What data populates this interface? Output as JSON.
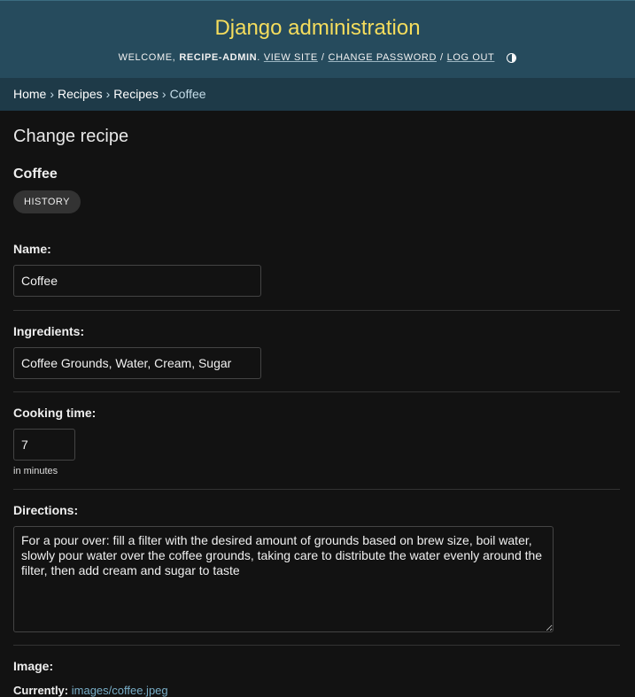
{
  "header": {
    "site_title": "Django administration",
    "welcome": "WELCOME,",
    "username": "RECIPE-ADMIN",
    "period": ".",
    "view_site": "VIEW SITE",
    "change_password": "CHANGE PASSWORD",
    "log_out": "LOG OUT",
    "sep": "/"
  },
  "breadcrumbs": [
    "Home",
    "Recipes",
    "Recipes",
    "Coffee"
  ],
  "page": {
    "title": "Change recipe",
    "object_name": "Coffee",
    "history_label": "HISTORY"
  },
  "form": {
    "name_label": "Name:",
    "name_value": "Coffee",
    "ingredients_label": "Ingredients:",
    "ingredients_value": "Coffee Grounds, Water, Cream, Sugar",
    "cooking_time_label": "Cooking time:",
    "cooking_time_value": "7",
    "cooking_time_help": "in minutes",
    "directions_label": "Directions:",
    "directions_value": "For a pour over: fill a filter with the desired amount of grounds based on brew size, boil water, slowly pour water over the coffee grounds, taking care to distribute the water evenly around the filter, then add cream and sugar to taste",
    "image_label": "Image:",
    "currently_label": "Currently:",
    "currently_value": "images/coffee.jpeg"
  },
  "colors": {
    "header_bg": "#264b5d",
    "branding": "#f5dd5d",
    "breadcrumbs_bg": "#1e3a48",
    "page_bg": "#121212",
    "link": "#79aec8"
  },
  "icons": {
    "theme_toggle": "half-circle-contrast-icon"
  }
}
